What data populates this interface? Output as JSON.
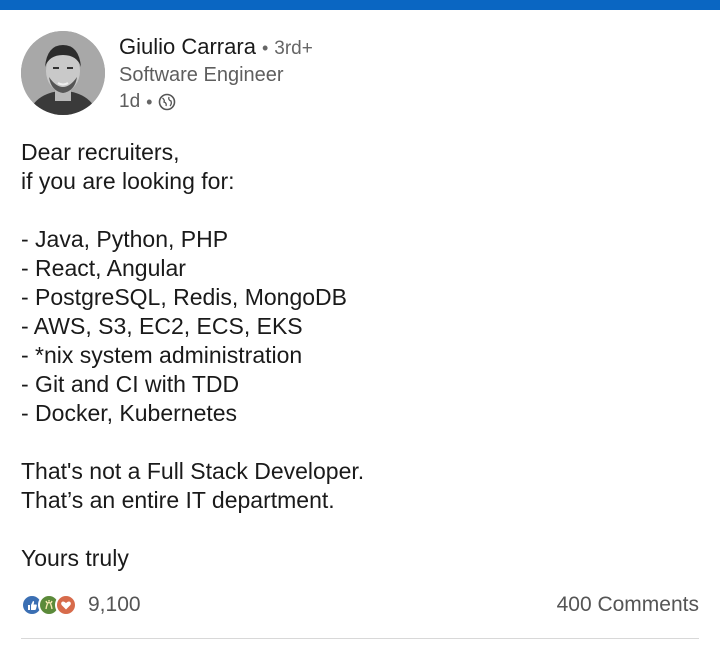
{
  "post": {
    "author_name": "Giulio Carrara",
    "degree": "3rd+",
    "headline": "Software Engineer",
    "age": "1d",
    "visibility_icon": "globe-icon",
    "body_lines": [
      "Dear recruiters,",
      "if you are looking for:",
      "",
      "- Java, Python, PHP",
      "- React, Angular",
      "- PostgreSQL, Redis, MongoDB",
      "- AWS, S3, EC2, ECS, EKS",
      "- *nix system administration",
      "- Git and CI with TDD",
      "- Docker, Kubernetes",
      "",
      "That's not a Full Stack Developer.",
      "That’s an entire IT department.",
      "",
      "Yours truly"
    ]
  },
  "engagement": {
    "reaction_icons": [
      "like-icon",
      "celebrate-icon",
      "love-icon"
    ],
    "reaction_count": "9,100",
    "comments": "400 Comments"
  },
  "colors": {
    "brand_blue": "#0a66c2",
    "like": "#3b6fb3",
    "celebrate": "#5b8a3a",
    "love": "#d76b4b"
  }
}
